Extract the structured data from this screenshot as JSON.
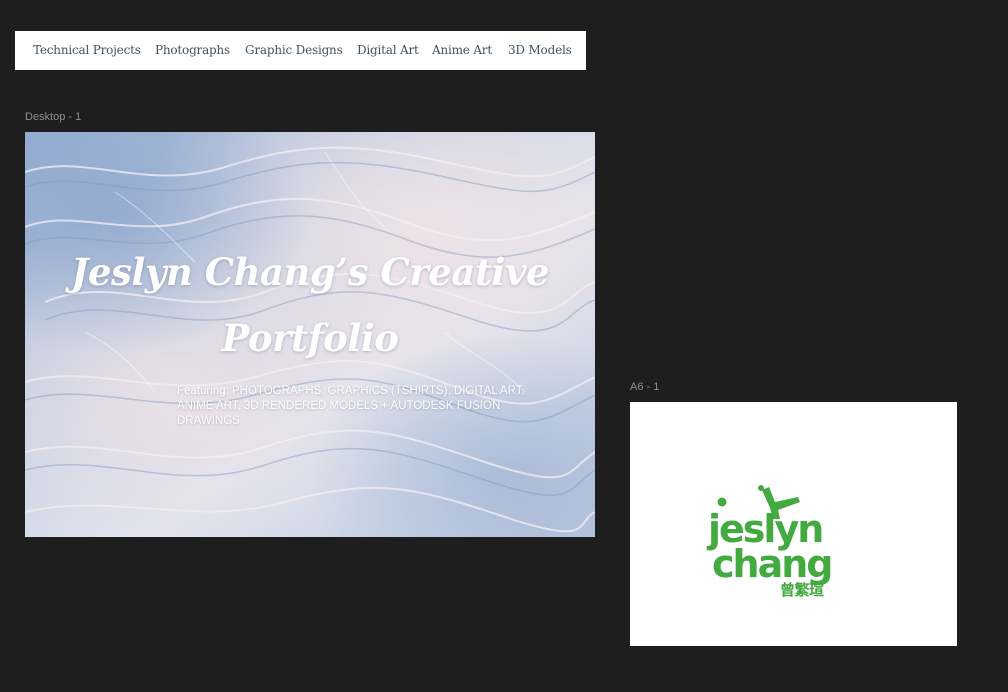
{
  "nav": {
    "links": [
      "Technical Projects",
      "Photographs",
      "Graphic Designs",
      "Digital Art",
      "Anime Art",
      "3D Models"
    ]
  },
  "frames": {
    "desktop_label": "Desktop - 1",
    "a6_label": "A6 - 1"
  },
  "hero": {
    "title_line1": "Jeslyn Chang’s Creative",
    "title_line2": "Portfolio",
    "subtitle": "Featuring: PHOTOGRAPHS, GRAPHICS (TSHIRTS), DIGITAL ART, ANIME ART, 3D RENDERED MODELS + AUTODESK FUSION DRAWINGS"
  },
  "logo": {
    "line1": "jeslyn",
    "line2": "chang",
    "chinese": "曾繁瑄",
    "color": "#43aa3f"
  },
  "colors": {
    "canvas": "#1e1e1e",
    "nav_text": "#3d5468",
    "label_text": "#8f8f8f"
  }
}
